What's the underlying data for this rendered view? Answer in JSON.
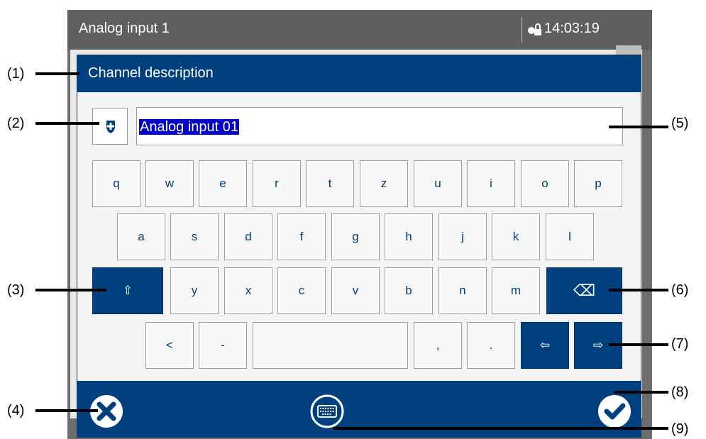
{
  "window": {
    "title": "Analog input 1",
    "time": "14:03:19"
  },
  "dialog": {
    "title": "Channel description",
    "input_value": "Analog input 01"
  },
  "keyboard": {
    "row1": [
      "q",
      "w",
      "e",
      "r",
      "t",
      "z",
      "u",
      "i",
      "o",
      "p"
    ],
    "row2": [
      "a",
      "s",
      "d",
      "f",
      "g",
      "h",
      "j",
      "k",
      "l"
    ],
    "row3": [
      "y",
      "x",
      "c",
      "v",
      "b",
      "n",
      "m"
    ],
    "row4": [
      "<",
      "-",
      "",
      ",",
      "."
    ],
    "shift_glyph": "⇧",
    "backspace_glyph": "⌫",
    "left_glyph": "⇦",
    "right_glyph": "⇨"
  },
  "callouts": [
    "(1)",
    "(2)",
    "(3)",
    "(4)",
    "(5)",
    "(6)",
    "(7)",
    "(8)",
    "(9)"
  ],
  "colors": {
    "accent": "#00407f",
    "selection": "#0000c8"
  }
}
